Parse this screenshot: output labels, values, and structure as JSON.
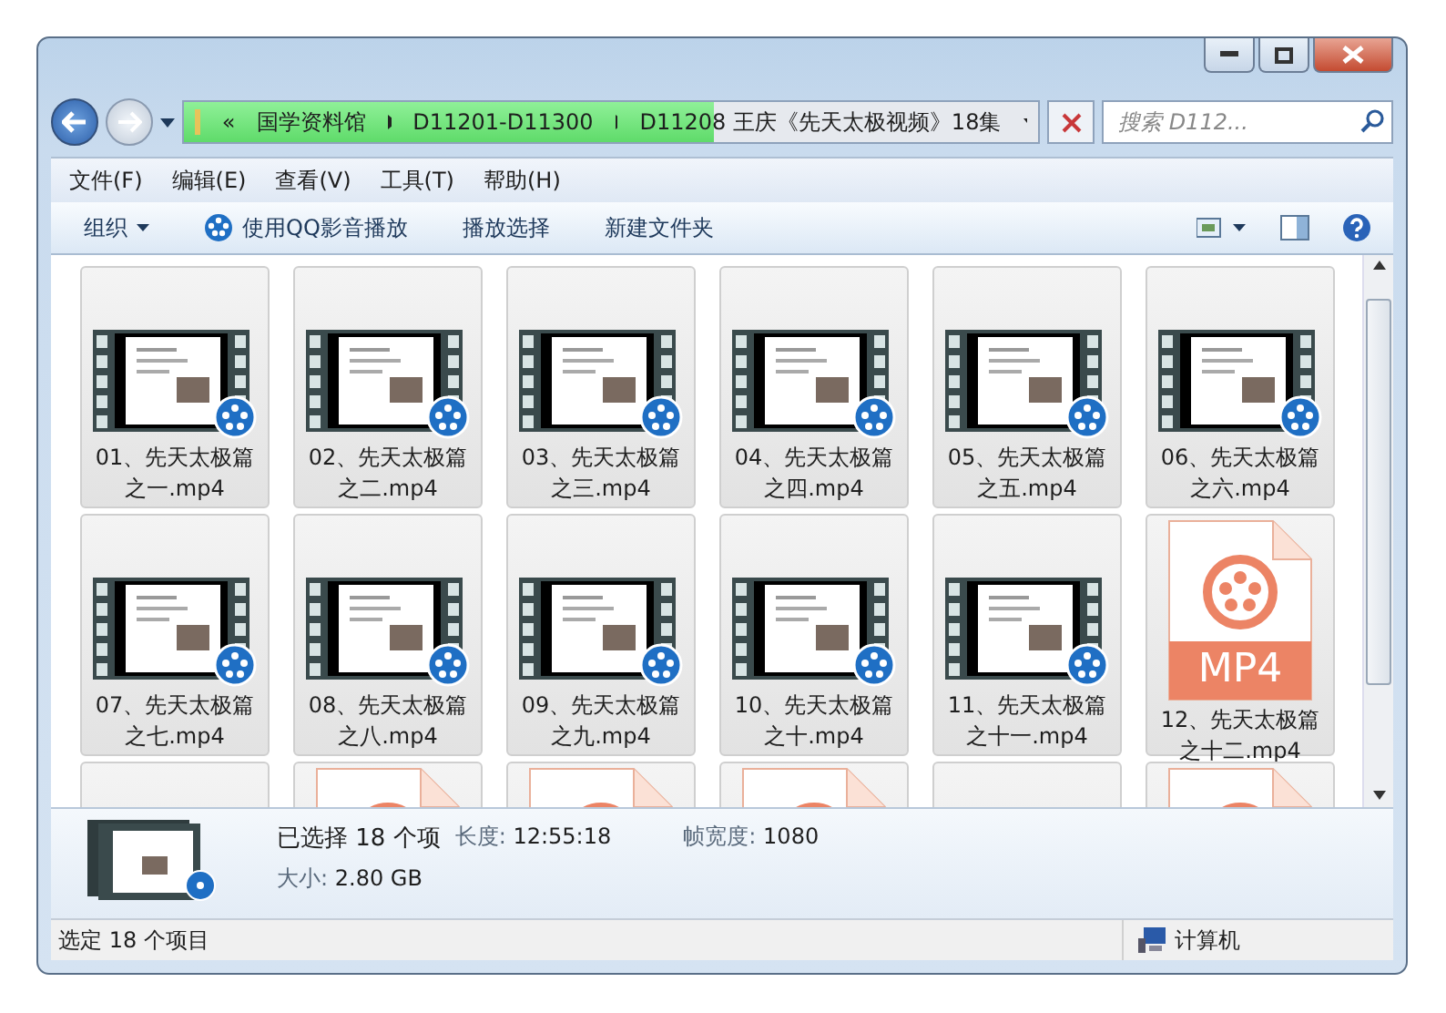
{
  "address": {
    "crumbs": [
      "«",
      "国学资料馆",
      "D11201-D11300",
      "D11208 王庆《先天太极视频》18集"
    ],
    "level": 0.62
  },
  "search": {
    "placeholder": "搜索 D112..."
  },
  "menu": [
    "文件(F)",
    "编辑(E)",
    "查看(V)",
    "工具(T)",
    "帮助(H)"
  ],
  "toolbar": [
    {
      "kind": "dropdown",
      "label": "组织"
    },
    {
      "kind": "app",
      "label": "使用QQ影音播放"
    },
    {
      "kind": "plain",
      "label": "播放选择"
    },
    {
      "kind": "plain",
      "label": "新建文件夹"
    }
  ],
  "files": [
    {
      "kind": "thumbnail",
      "label": "01、先天太极篇之一.mp4",
      "selected": true
    },
    {
      "kind": "thumbnail",
      "label": "02、先天太极篇之二.mp4",
      "selected": true
    },
    {
      "kind": "thumbnail",
      "label": "03、先天太极篇之三.mp4",
      "selected": true
    },
    {
      "kind": "thumbnail",
      "label": "04、先天太极篇之四.mp4",
      "selected": true
    },
    {
      "kind": "thumbnail",
      "label": "05、先天太极篇之五.mp4",
      "selected": true
    },
    {
      "kind": "thumbnail",
      "label": "06、先天太极篇之六.mp4",
      "selected": true
    },
    {
      "kind": "thumbnail",
      "label": "07、先天太极篇之七.mp4",
      "selected": true
    },
    {
      "kind": "thumbnail",
      "label": "08、先天太极篇之八.mp4",
      "selected": true
    },
    {
      "kind": "thumbnail",
      "label": "09、先天太极篇之九.mp4",
      "selected": true
    },
    {
      "kind": "thumbnail",
      "label": "10、先天太极篇之十.mp4",
      "selected": true
    },
    {
      "kind": "thumbnail",
      "label": "11、先天太极篇之十一.mp4",
      "selected": true
    },
    {
      "kind": "mp4",
      "label": "12、先天太极篇之十二.mp4",
      "badge": "MP4",
      "selected": true
    },
    {
      "kind": "blank",
      "selected": true
    },
    {
      "kind": "mp4",
      "selected": true
    },
    {
      "kind": "mp4",
      "selected": true
    },
    {
      "kind": "mp4",
      "selected": true
    },
    {
      "kind": "blank",
      "selected": true
    },
    {
      "kind": "mp4",
      "selected": true
    }
  ],
  "details": {
    "summary": "已选择 18 个项",
    "fields": [
      {
        "label": "长度:",
        "value": "12:55:18"
      },
      {
        "label": "帧宽度:",
        "value": "1080"
      },
      {
        "label": "大小:",
        "value": "2.80 GB"
      }
    ]
  },
  "status_bar": {
    "text": "选定 18 个项目",
    "location": "计算机"
  }
}
